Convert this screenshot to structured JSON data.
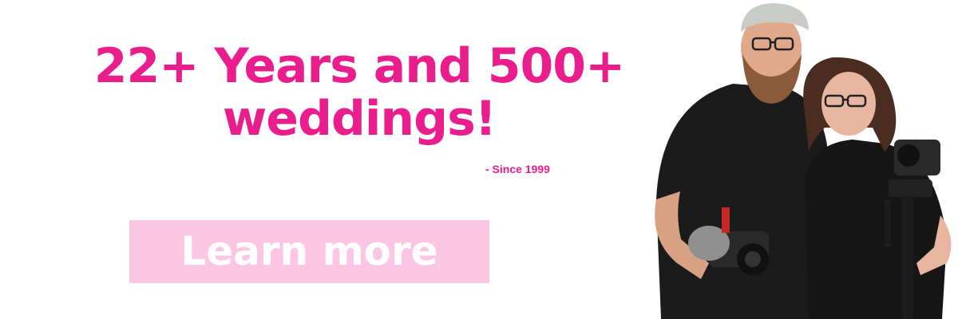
{
  "banner": {
    "headline_line1": "22+ Years and 500+",
    "headline_line2": "weddings!",
    "since": "- Since 1999",
    "cta_label": "Learn more"
  },
  "colors": {
    "accent": "#e91e8c",
    "button_bg": "#fbc6e4",
    "button_text": "#ffffff",
    "background": "#ffffff"
  }
}
